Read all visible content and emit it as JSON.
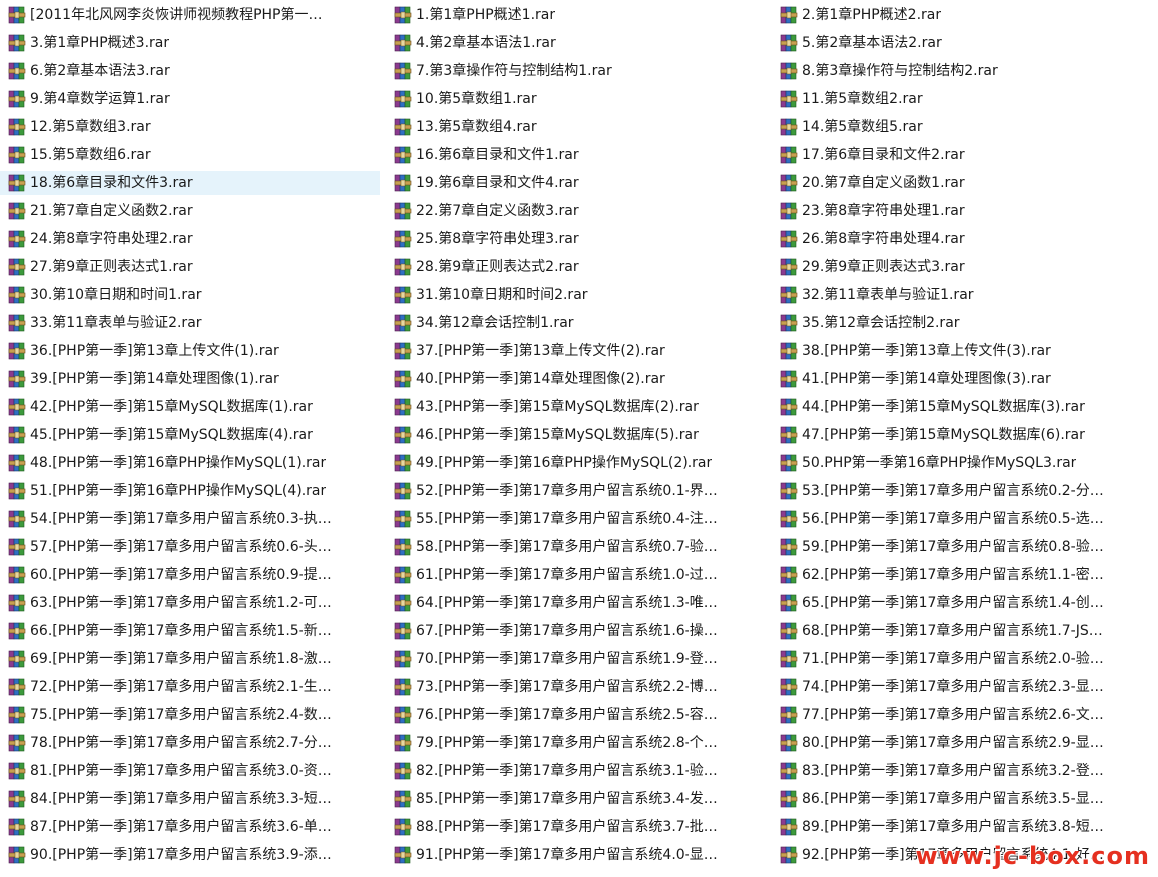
{
  "files": [
    {
      "name": "[2011年北风网李炎恢讲师视频教程PHP第一…",
      "icon": "winrar-archive-icon"
    },
    {
      "name": "1.第1章PHP概述1.rar",
      "icon": "winrar-archive-icon"
    },
    {
      "name": "2.第1章PHP概述2.rar",
      "icon": "winrar-archive-icon"
    },
    {
      "name": "3.第1章PHP概述3.rar",
      "icon": "winrar-archive-icon"
    },
    {
      "name": "4.第2章基本语法1.rar",
      "icon": "winrar-archive-icon"
    },
    {
      "name": "5.第2章基本语法2.rar",
      "icon": "winrar-archive-icon"
    },
    {
      "name": "6.第2章基本语法3.rar",
      "icon": "winrar-archive-icon"
    },
    {
      "name": "7.第3章操作符与控制结构1.rar",
      "icon": "winrar-archive-icon"
    },
    {
      "name": "8.第3章操作符与控制结构2.rar",
      "icon": "winrar-archive-icon"
    },
    {
      "name": "9.第4章数学运算1.rar",
      "icon": "winrar-archive-icon"
    },
    {
      "name": "10.第5章数组1.rar",
      "icon": "winrar-archive-icon"
    },
    {
      "name": "11.第5章数组2.rar",
      "icon": "winrar-archive-icon"
    },
    {
      "name": "12.第5章数组3.rar",
      "icon": "winrar-archive-icon"
    },
    {
      "name": "13.第5章数组4.rar",
      "icon": "winrar-archive-icon"
    },
    {
      "name": "14.第5章数组5.rar",
      "icon": "winrar-archive-icon"
    },
    {
      "name": "15.第5章数组6.rar",
      "icon": "winrar-archive-icon"
    },
    {
      "name": "16.第6章目录和文件1.rar",
      "icon": "winrar-archive-icon"
    },
    {
      "name": "17.第6章目录和文件2.rar",
      "icon": "winrar-archive-icon"
    },
    {
      "name": "18.第6章目录和文件3.rar",
      "icon": "winrar-archive-icon",
      "selected": true
    },
    {
      "name": "19.第6章目录和文件4.rar",
      "icon": "winrar-archive-icon"
    },
    {
      "name": "20.第7章自定义函数1.rar",
      "icon": "winrar-archive-icon"
    },
    {
      "name": "21.第7章自定义函数2.rar",
      "icon": "winrar-archive-icon"
    },
    {
      "name": "22.第7章自定义函数3.rar",
      "icon": "winrar-archive-icon"
    },
    {
      "name": "23.第8章字符串处理1.rar",
      "icon": "winrar-archive-icon"
    },
    {
      "name": "24.第8章字符串处理2.rar",
      "icon": "winrar-archive-icon"
    },
    {
      "name": "25.第8章字符串处理3.rar",
      "icon": "winrar-archive-icon"
    },
    {
      "name": "26.第8章字符串处理4.rar",
      "icon": "winrar-archive-icon"
    },
    {
      "name": "27.第9章正则表达式1.rar",
      "icon": "winrar-archive-icon"
    },
    {
      "name": "28.第9章正则表达式2.rar",
      "icon": "winrar-archive-icon"
    },
    {
      "name": "29.第9章正则表达式3.rar",
      "icon": "winrar-archive-icon"
    },
    {
      "name": "30.第10章日期和时间1.rar",
      "icon": "winrar-archive-icon"
    },
    {
      "name": "31.第10章日期和时间2.rar",
      "icon": "winrar-archive-icon"
    },
    {
      "name": "32.第11章表单与验证1.rar",
      "icon": "winrar-archive-icon"
    },
    {
      "name": "33.第11章表单与验证2.rar",
      "icon": "winrar-archive-icon"
    },
    {
      "name": "34.第12章会话控制1.rar",
      "icon": "winrar-archive-icon"
    },
    {
      "name": "35.第12章会话控制2.rar",
      "icon": "winrar-archive-icon"
    },
    {
      "name": "36.[PHP第一季]第13章上传文件(1).rar",
      "icon": "winrar-archive-icon"
    },
    {
      "name": "37.[PHP第一季]第13章上传文件(2).rar",
      "icon": "winrar-archive-icon"
    },
    {
      "name": "38.[PHP第一季]第13章上传文件(3).rar",
      "icon": "winrar-archive-icon"
    },
    {
      "name": "39.[PHP第一季]第14章处理图像(1).rar",
      "icon": "winrar-archive-icon"
    },
    {
      "name": "40.[PHP第一季]第14章处理图像(2).rar",
      "icon": "winrar-archive-icon"
    },
    {
      "name": "41.[PHP第一季]第14章处理图像(3).rar",
      "icon": "winrar-archive-icon"
    },
    {
      "name": "42.[PHP第一季]第15章MySQL数据库(1).rar",
      "icon": "winrar-archive-icon"
    },
    {
      "name": "43.[PHP第一季]第15章MySQL数据库(2).rar",
      "icon": "winrar-archive-icon"
    },
    {
      "name": "44.[PHP第一季]第15章MySQL数据库(3).rar",
      "icon": "winrar-archive-icon"
    },
    {
      "name": "45.[PHP第一季]第15章MySQL数据库(4).rar",
      "icon": "winrar-archive-icon"
    },
    {
      "name": "46.[PHP第一季]第15章MySQL数据库(5).rar",
      "icon": "winrar-archive-icon"
    },
    {
      "name": "47.[PHP第一季]第15章MySQL数据库(6).rar",
      "icon": "winrar-archive-icon"
    },
    {
      "name": "48.[PHP第一季]第16章PHP操作MySQL(1).rar",
      "icon": "winrar-archive-icon"
    },
    {
      "name": "49.[PHP第一季]第16章PHP操作MySQL(2).rar",
      "icon": "winrar-archive-icon"
    },
    {
      "name": "50.PHP第一季第16章PHP操作MySQL3.rar",
      "icon": "winrar-archive-icon"
    },
    {
      "name": "51.[PHP第一季]第16章PHP操作MySQL(4).rar",
      "icon": "winrar-archive-icon"
    },
    {
      "name": "52.[PHP第一季]第17章多用户留言系统0.1-界…",
      "icon": "winrar-archive-icon"
    },
    {
      "name": "53.[PHP第一季]第17章多用户留言系统0.2-分…",
      "icon": "winrar-archive-icon"
    },
    {
      "name": "54.[PHP第一季]第17章多用户留言系统0.3-执…",
      "icon": "winrar-archive-icon"
    },
    {
      "name": "55.[PHP第一季]第17章多用户留言系统0.4-注…",
      "icon": "winrar-archive-icon"
    },
    {
      "name": "56.[PHP第一季]第17章多用户留言系统0.5-选…",
      "icon": "winrar-archive-icon"
    },
    {
      "name": "57.[PHP第一季]第17章多用户留言系统0.6-头…",
      "icon": "winrar-archive-icon"
    },
    {
      "name": "58.[PHP第一季]第17章多用户留言系统0.7-验…",
      "icon": "winrar-archive-icon"
    },
    {
      "name": "59.[PHP第一季]第17章多用户留言系统0.8-验…",
      "icon": "winrar-archive-icon"
    },
    {
      "name": "60.[PHP第一季]第17章多用户留言系统0.9-提…",
      "icon": "winrar-archive-icon"
    },
    {
      "name": "61.[PHP第一季]第17章多用户留言系统1.0-过…",
      "icon": "winrar-archive-icon"
    },
    {
      "name": "62.[PHP第一季]第17章多用户留言系统1.1-密…",
      "icon": "winrar-archive-icon"
    },
    {
      "name": "63.[PHP第一季]第17章多用户留言系统1.2-可…",
      "icon": "winrar-archive-icon"
    },
    {
      "name": "64.[PHP第一季]第17章多用户留言系统1.3-唯…",
      "icon": "winrar-archive-icon"
    },
    {
      "name": "65.[PHP第一季]第17章多用户留言系统1.4-创…",
      "icon": "winrar-archive-icon"
    },
    {
      "name": "66.[PHP第一季]第17章多用户留言系统1.5-新…",
      "icon": "winrar-archive-icon"
    },
    {
      "name": "67.[PHP第一季]第17章多用户留言系统1.6-操…",
      "icon": "winrar-archive-icon"
    },
    {
      "name": "68.[PHP第一季]第17章多用户留言系统1.7-JS…",
      "icon": "winrar-archive-icon"
    },
    {
      "name": "69.[PHP第一季]第17章多用户留言系统1.8-激…",
      "icon": "winrar-archive-icon"
    },
    {
      "name": "70.[PHP第一季]第17章多用户留言系统1.9-登…",
      "icon": "winrar-archive-icon"
    },
    {
      "name": "71.[PHP第一季]第17章多用户留言系统2.0-验…",
      "icon": "winrar-archive-icon"
    },
    {
      "name": "72.[PHP第一季]第17章多用户留言系统2.1-生…",
      "icon": "winrar-archive-icon"
    },
    {
      "name": "73.[PHP第一季]第17章多用户留言系统2.2-博…",
      "icon": "winrar-archive-icon"
    },
    {
      "name": "74.[PHP第一季]第17章多用户留言系统2.3-显…",
      "icon": "winrar-archive-icon"
    },
    {
      "name": "75.[PHP第一季]第17章多用户留言系统2.4-数…",
      "icon": "winrar-archive-icon"
    },
    {
      "name": "76.[PHP第一季]第17章多用户留言系统2.5-容…",
      "icon": "winrar-archive-icon"
    },
    {
      "name": "77.[PHP第一季]第17章多用户留言系统2.6-文…",
      "icon": "winrar-archive-icon"
    },
    {
      "name": "78.[PHP第一季]第17章多用户留言系统2.7-分…",
      "icon": "winrar-archive-icon"
    },
    {
      "name": "79.[PHP第一季]第17章多用户留言系统2.8-个…",
      "icon": "winrar-archive-icon"
    },
    {
      "name": "80.[PHP第一季]第17章多用户留言系统2.9-显…",
      "icon": "winrar-archive-icon"
    },
    {
      "name": "81.[PHP第一季]第17章多用户留言系统3.0-资…",
      "icon": "winrar-archive-icon"
    },
    {
      "name": "82.[PHP第一季]第17章多用户留言系统3.1-验…",
      "icon": "winrar-archive-icon"
    },
    {
      "name": "83.[PHP第一季]第17章多用户留言系统3.2-登…",
      "icon": "winrar-archive-icon"
    },
    {
      "name": "84.[PHP第一季]第17章多用户留言系统3.3-短…",
      "icon": "winrar-archive-icon"
    },
    {
      "name": "85.[PHP第一季]第17章多用户留言系统3.4-发…",
      "icon": "winrar-archive-icon"
    },
    {
      "name": "86.[PHP第一季]第17章多用户留言系统3.5-显…",
      "icon": "winrar-archive-icon"
    },
    {
      "name": "87.[PHP第一季]第17章多用户留言系统3.6-单…",
      "icon": "winrar-archive-icon"
    },
    {
      "name": "88.[PHP第一季]第17章多用户留言系统3.7-批…",
      "icon": "winrar-archive-icon"
    },
    {
      "name": "89.[PHP第一季]第17章多用户留言系统3.8-短…",
      "icon": "winrar-archive-icon"
    },
    {
      "name": "90.[PHP第一季]第17章多用户留言系统3.9-添…",
      "icon": "winrar-archive-icon"
    },
    {
      "name": "91.[PHP第一季]第17章多用户留言系统4.0-显…",
      "icon": "winrar-archive-icon"
    },
    {
      "name": "92.[PHP第一季]第17章多用户留言系统4.1-好…",
      "icon": "winrar-archive-icon"
    }
  ],
  "watermark": {
    "text": "www.jc-box.com",
    "color": "#e53020"
  },
  "colors": {
    "selection": "#e5f3fb",
    "text": "#1a1a1a"
  }
}
